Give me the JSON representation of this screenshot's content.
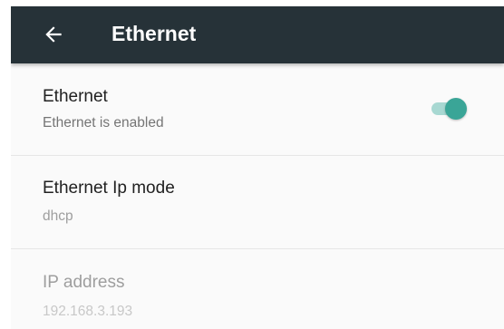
{
  "toolbar": {
    "title": "Ethernet",
    "back_icon": "arrow-left-icon",
    "background_color": "#263238"
  },
  "settings": [
    {
      "title": "Ethernet",
      "summary": "Ethernet is enabled",
      "control": "toggle",
      "toggle_on": true,
      "accent_color": "#3aa597"
    },
    {
      "title": "Ethernet Ip mode",
      "summary": "dhcp"
    },
    {
      "title": "IP address",
      "summary": "192.168.3.193",
      "disabled": true
    }
  ]
}
